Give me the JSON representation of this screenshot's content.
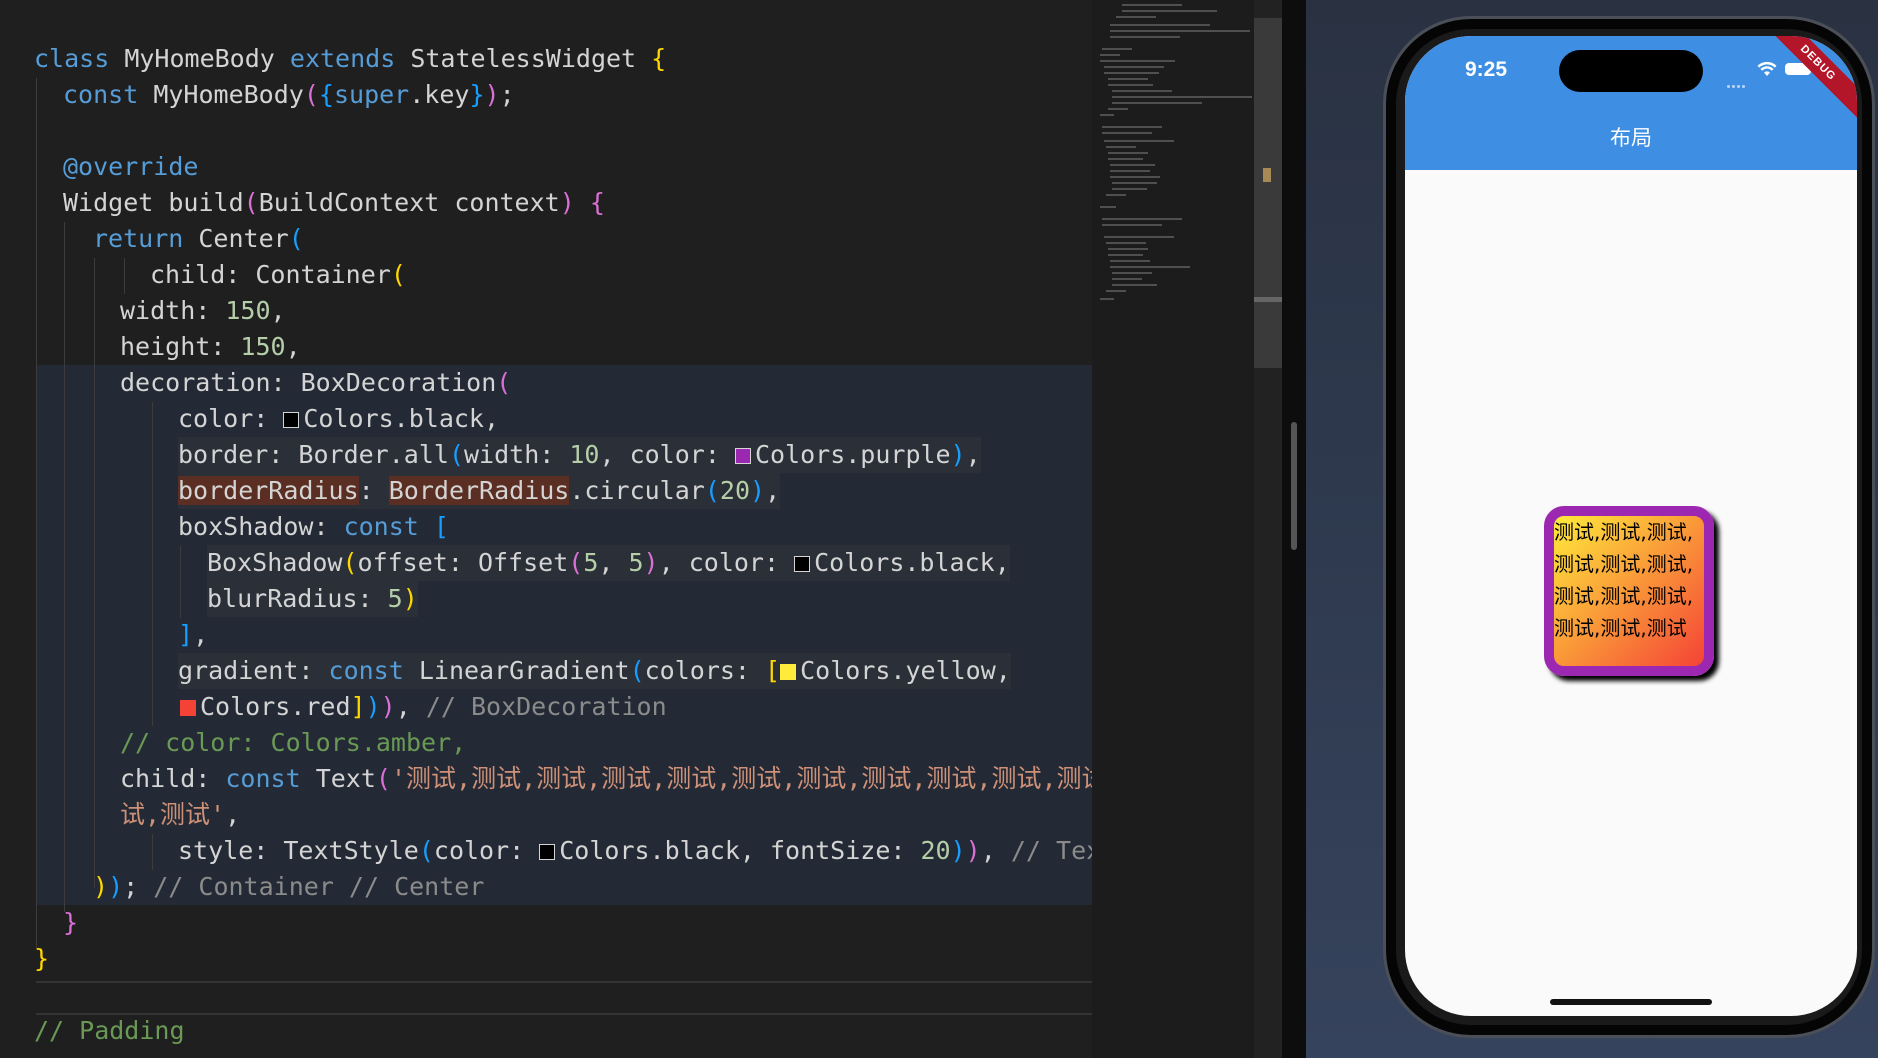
{
  "code": {
    "l1": {
      "kw_class": "class",
      "name": "MyHomeBody",
      "kw_extends": "extends",
      "base": "StatelessWidget",
      "brace": "{"
    },
    "l2": {
      "kw_const": "const",
      "ctor": "MyHomeBody",
      "p1": "(",
      "p2": "{",
      "kw_super": "super",
      "rest": ".key",
      "p3": "}",
      "p4": ")",
      "semi": ";"
    },
    "l3": {
      "text": "@override"
    },
    "l4": {
      "text": "Widget build",
      "p1": "(",
      "args": "BuildContext context",
      "p2": ")",
      "brace": "{"
    },
    "l5": {
      "kw_return": "return",
      "text": "Center",
      "p": "("
    },
    "l6": {
      "text": "child: Container",
      "p": "("
    },
    "l7": {
      "key": "width: ",
      "num": "150",
      "comma": ","
    },
    "l8": {
      "key": "height: ",
      "num": "150",
      "comma": ","
    },
    "l9": {
      "text": "decoration: BoxDecoration",
      "p": "("
    },
    "l10": {
      "key": "color: ",
      "val": "Colors.black",
      "comma": ","
    },
    "l11": {
      "key": "border: Border.all",
      "p1": "(",
      "a1": "width: ",
      "n1": "10",
      "a2": ", color: ",
      "val": "Colors.purple",
      "p2": ")",
      "comma": ","
    },
    "l12": {
      "key": "borderRadius",
      "colon": ": ",
      "cls": "BorderRadius",
      "rest": ".circular",
      "p1": "(",
      "num": "20",
      "p2": ")",
      "comma": ","
    },
    "l13": {
      "key": "boxShadow: ",
      "kw_const": "const",
      "br": "["
    },
    "l14": {
      "text": "BoxShadow",
      "p1": "(",
      "a1": "offset: Offset",
      "p2": "(",
      "n1": "5",
      "sep": ", ",
      "n2": "5",
      "p3": ")",
      "a2": ", color: ",
      "val": "Colors.black",
      "comma": ","
    },
    "l15": {
      "key": "blurRadius: ",
      "num": "5",
      "p": ")"
    },
    "l16": {
      "br": "]",
      "comma": ","
    },
    "l17": {
      "key": "gradient: ",
      "kw_const": "const",
      "cls": "LinearGradient",
      "p1": "(",
      "a1": "colors: ",
      "br": "[",
      "val": "Colors.yellow",
      "comma": ","
    },
    "l18": {
      "val": "Colors.red",
      "br": "]",
      "p1": ")",
      "p2": ")",
      "comma": ",",
      "comment": "// BoxDecoration"
    },
    "l19": {
      "comment": "// color: Colors.amber,"
    },
    "l20": {
      "key": "child: ",
      "kw_const": "const",
      "cls": "Text",
      "p": "(",
      "str": "'测试,测试,测试,测试,测试,测试,测试,测试,测试,测试,测试,测"
    },
    "l21": {
      "str": "试,测试'",
      "comma": ","
    },
    "l22": {
      "key": "style: TextStyle",
      "p1": "(",
      "a1": "color: ",
      "val": "Colors.black",
      "a2": ", fontSize: ",
      "num": "20",
      "p2": ")",
      "p3": ")",
      "comma": ",",
      "comment": "// Text"
    },
    "l23": {
      "p1": ")",
      "p2": ")",
      "semi": ";",
      "comment": "// Container // Center"
    },
    "l24": {
      "brace": "}"
    },
    "l25": {
      "brace": "}"
    },
    "l27": {
      "comment": "// Padding"
    }
  },
  "colors": {
    "black": "#000000",
    "purple": "#9c27b0",
    "yellow": "#ffeb3b",
    "red": "#f44336",
    "appbar": "#3e8fe4"
  },
  "phone": {
    "time": "9:25",
    "title": "布局",
    "debug": "DEBUG",
    "box_text": "测试,测试,测试,测试,测试,测试,测试,测试,测试,测试,测试,测试"
  }
}
